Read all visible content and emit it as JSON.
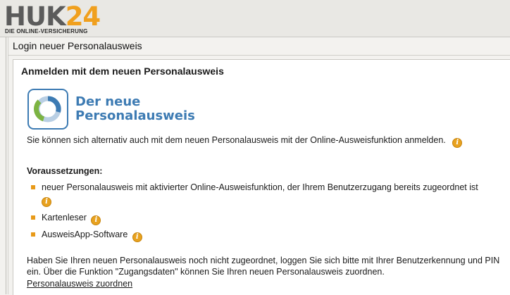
{
  "header": {
    "logo_brand": "HUK",
    "logo_number": "24",
    "logo_tagline": "DIE ONLINE-VERSICHERUNG"
  },
  "panel": {
    "title": "Login neuer Personalausweis"
  },
  "card": {
    "title": "Anmelden mit dem neuen Personalausweis",
    "logo_text_line1": "Der neue",
    "logo_text_line2": "Personalausweis",
    "intro": "Sie können sich alternativ auch mit dem neuen Personalausweis mit der Online-Ausweisfunktion anmelden.",
    "prereq_title": "Voraussetzungen:",
    "prerequisites": [
      "neuer Personalausweis mit aktivierter Online-Ausweisfunktion, der Ihrem Benutzerzugang bereits zugeordnet ist",
      "Kartenleser",
      "AusweisApp-Software"
    ],
    "info_glyph": "i",
    "bottom_text": "Haben Sie Ihren neuen Personalausweis noch nicht zugeordnet, loggen Sie sich bitte mit Ihrer Benutzerkennung und PIN ein. Über die Funktion \"Zugangsdaten\" können Sie Ihren neuen Personalausweis zuordnen.",
    "assign_link": "Personalausweis zuordnen"
  },
  "colors": {
    "accent_orange": "#e89a18",
    "logo_blue": "#3d7bb3",
    "logo_green": "#7cb342"
  }
}
